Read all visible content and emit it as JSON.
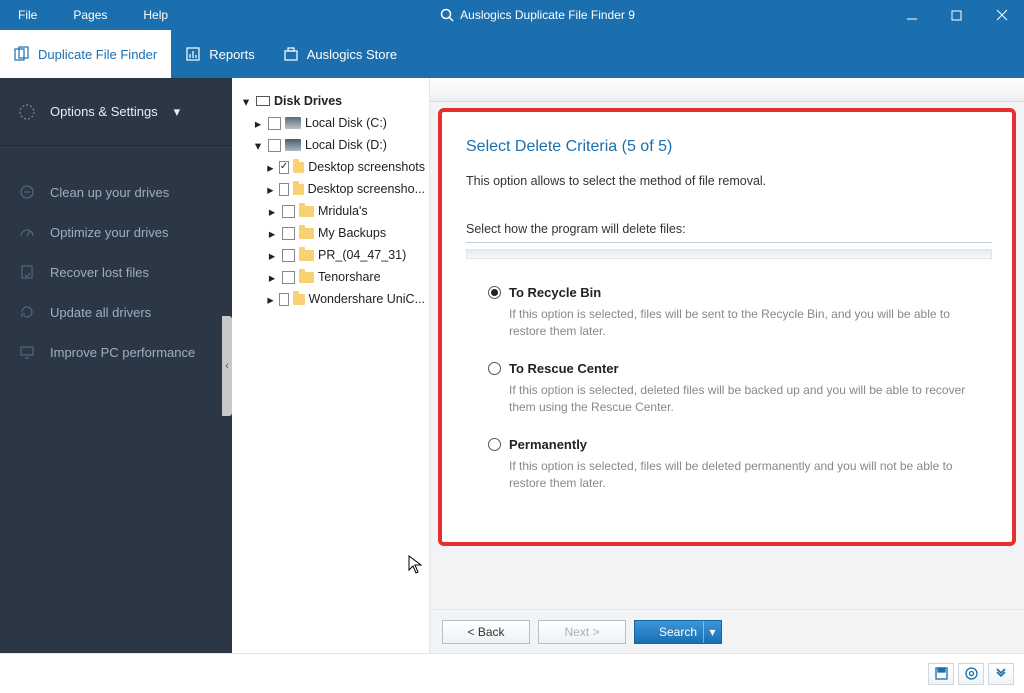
{
  "titlebar": {
    "menu": {
      "file": "File",
      "pages": "Pages",
      "help": "Help"
    },
    "title": "Auslogics Duplicate File Finder 9"
  },
  "tabs": {
    "finder": "Duplicate File Finder",
    "reports": "Reports",
    "store": "Auslogics Store"
  },
  "sidebar": {
    "options": "Options & Settings",
    "items": [
      {
        "label": "Clean up your drives"
      },
      {
        "label": "Optimize your drives"
      },
      {
        "label": "Recover lost files"
      },
      {
        "label": "Update all drivers"
      },
      {
        "label": "Improve PC performance"
      }
    ]
  },
  "tree": {
    "root": "Disk Drives",
    "c": "Local Disk (C:)",
    "d": "Local Disk (D:)",
    "d_children": [
      {
        "label": "Desktop screenshots",
        "checked": true
      },
      {
        "label": "Desktop screensho...",
        "checked": false
      },
      {
        "label": "Mridula's",
        "checked": false
      },
      {
        "label": "My Backups",
        "checked": false
      },
      {
        "label": "PR_(04_47_31)",
        "checked": false
      },
      {
        "label": "Tenorshare",
        "checked": false
      },
      {
        "label": "Wondershare UniC...",
        "checked": false
      }
    ]
  },
  "panel": {
    "title": "Select Delete Criteria (5 of 5)",
    "desc": "This option allows to select the method of file removal.",
    "sublabel": "Select how the program will delete files:",
    "options": [
      {
        "label": "To Recycle Bin",
        "desc": "If this option is selected, files will be sent to the Recycle Bin, and you will be able to restore them later.",
        "selected": true
      },
      {
        "label": "To Rescue Center",
        "desc": "If this option is selected, deleted files will be backed up and you will be able to recover them using the Rescue Center.",
        "selected": false
      },
      {
        "label": "Permanently",
        "desc": "If this option is selected, files will be deleted permanently and you will not be able to restore them later.",
        "selected": false
      }
    ]
  },
  "buttons": {
    "back": "< Back",
    "next": "Next >",
    "search": "Search"
  }
}
